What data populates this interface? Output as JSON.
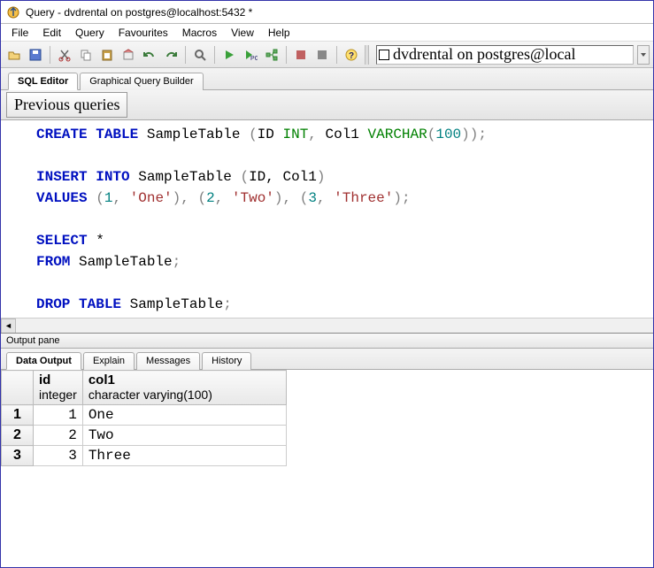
{
  "window": {
    "title": "Query - dvdrental on postgres@localhost:5432 *"
  },
  "menu": {
    "items": [
      "File",
      "Edit",
      "Query",
      "Favourites",
      "Macros",
      "View",
      "Help"
    ]
  },
  "connection": {
    "label": "dvdrental on postgres@local"
  },
  "editor_tabs": {
    "sql": "SQL Editor",
    "gqb": "Graphical Query Builder"
  },
  "prev_queries_btn": "Previous queries",
  "sql": {
    "l1": {
      "create": "CREATE",
      "table": "TABLE",
      "name": " SampleTable ",
      "lp": "(",
      "id": "ID ",
      "int": "INT",
      "c1": ", ",
      "col1": "Col1 ",
      "vc": "VARCHAR",
      "lp2": "(",
      "n100": "100",
      "rp2": ")",
      "rp": ")",
      "sc": ";"
    },
    "l3": {
      "insert": "INSERT",
      "into": "INTO",
      "name": " SampleTable ",
      "lp": "(",
      "cols": "ID, Col1",
      "rp": ")"
    },
    "l4": {
      "values": "VALUES",
      "sp": " ",
      "lp1": "(",
      "n1": "1",
      "c1": ", ",
      "s1": "'One'",
      "rp1": ")",
      "c2": ", ",
      "lp2": "(",
      "n2": "2",
      "c3": ", ",
      "s2": "'Two'",
      "rp2": ")",
      "c4": ", ",
      "lp3": "(",
      "n3": "3",
      "c5": ", ",
      "s3": "'Three'",
      "rp3": ")",
      "sc": ";"
    },
    "l6": {
      "select": "SELECT",
      "star": " *"
    },
    "l7": {
      "from": "FROM",
      "tbl": " SampleTable",
      "sc": ";"
    },
    "l9": {
      "drop": "DROP",
      "table": "TABLE",
      "tbl": " SampleTable",
      "sc": ";"
    }
  },
  "output_pane_label": "Output pane",
  "output_tabs": {
    "data": "Data Output",
    "explain": "Explain",
    "messages": "Messages",
    "history": "History"
  },
  "grid": {
    "col1": {
      "name": "id",
      "type": "integer"
    },
    "col2": {
      "name": "col1",
      "type": "character varying(100)"
    },
    "rows": [
      {
        "n": "1",
        "id": "1",
        "col1": "One"
      },
      {
        "n": "2",
        "id": "2",
        "col1": "Two"
      },
      {
        "n": "3",
        "id": "3",
        "col1": "Three"
      }
    ]
  }
}
